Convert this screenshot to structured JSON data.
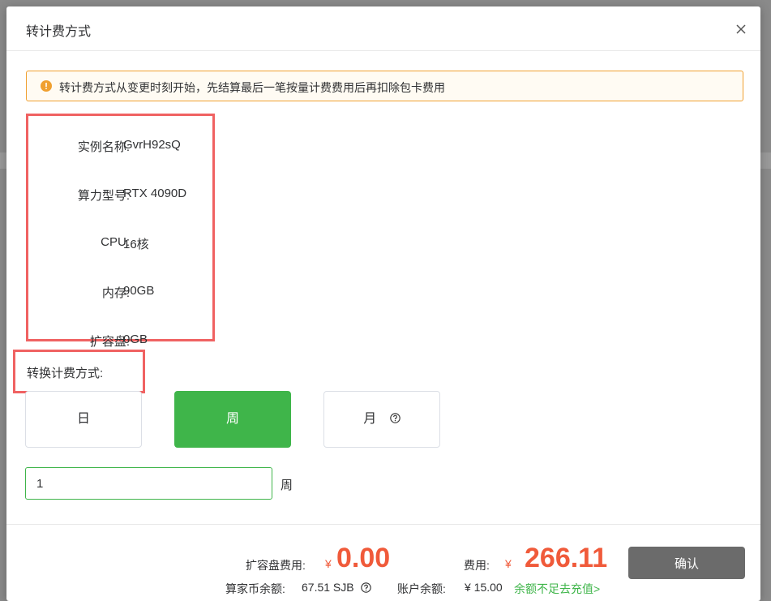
{
  "dialog": {
    "title": "转计费方式",
    "close_icon": "close-icon"
  },
  "notice": {
    "icon": "warning-circle-icon",
    "text": "转计费方式从变更时刻开始，先结算最后一笔按量计费费用后再扣除包卡费用",
    "color": "#f0a030"
  },
  "instance_info": [
    {
      "label": "实例名称:",
      "value": "GvrH92sQ"
    },
    {
      "label": "算力型号:",
      "value": "RTX 4090D"
    },
    {
      "label": "CPU:",
      "value": "16核"
    },
    {
      "label": "内存:",
      "value": "90GB"
    },
    {
      "label": "扩容盘:",
      "value": "0GB"
    }
  ],
  "switch_billing": {
    "label": "转换计费方式:",
    "options": [
      {
        "label": "日",
        "active": false
      },
      {
        "label": "周",
        "active": true
      },
      {
        "label": "月",
        "active": false,
        "help_icon": "question-circle-icon"
      }
    ]
  },
  "quantity": {
    "value": "1",
    "unit": "周"
  },
  "footer": {
    "disk_fee_label": "扩容盘费用:",
    "disk_fee_currency": "¥",
    "disk_fee_amount": "0.00",
    "fee_label": "费用:",
    "fee_currency": "¥",
    "fee_amount": "266.11",
    "coin_balance_label": "算家币余额:",
    "coin_balance_value": "67.51 SJB",
    "account_balance_label": "账户余额:",
    "account_balance_value": "¥ 15.00",
    "recharge_text": "余额不足去充值>",
    "confirm_label": "确认"
  },
  "colors": {
    "accent_green": "#3fb54a",
    "price_red": "#f05a3a",
    "highlight_red": "#f06262"
  }
}
